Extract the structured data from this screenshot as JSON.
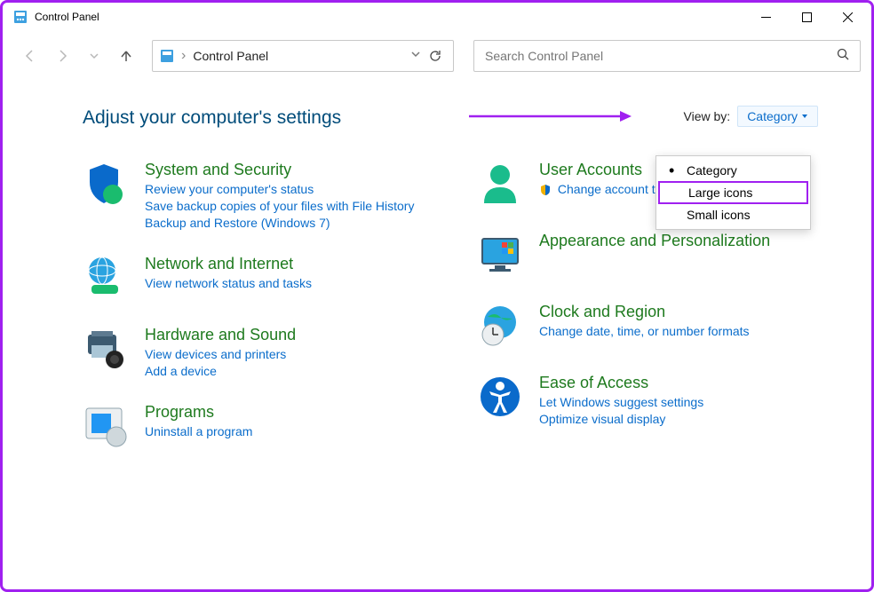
{
  "window": {
    "title": "Control Panel"
  },
  "address": {
    "text": "Control Panel"
  },
  "search": {
    "placeholder": "Search Control Panel"
  },
  "page": {
    "heading": "Adjust your computer's settings",
    "viewby_label": "View by:",
    "viewby_value": "Category",
    "dropdown": {
      "items": [
        "Category",
        "Large icons",
        "Small icons"
      ],
      "selected": 0,
      "highlighted": 1
    }
  },
  "left": [
    {
      "title": "System and Security",
      "links": [
        "Review your computer's status",
        "Save backup copies of your files with File History",
        "Backup and Restore (Windows 7)"
      ]
    },
    {
      "title": "Network and Internet",
      "links": [
        "View network status and tasks"
      ]
    },
    {
      "title": "Hardware and Sound",
      "links": [
        "View devices and printers",
        "Add a device"
      ]
    },
    {
      "title": "Programs",
      "links": [
        "Uninstall a program"
      ]
    }
  ],
  "right": [
    {
      "title": "User Accounts",
      "links": [
        "Change account type"
      ],
      "shield": true
    },
    {
      "title": "Appearance and Personalization",
      "links": []
    },
    {
      "title": "Clock and Region",
      "links": [
        "Change date, time, or number formats"
      ]
    },
    {
      "title": "Ease of Access",
      "links": [
        "Let Windows suggest settings",
        "Optimize visual display"
      ]
    }
  ]
}
